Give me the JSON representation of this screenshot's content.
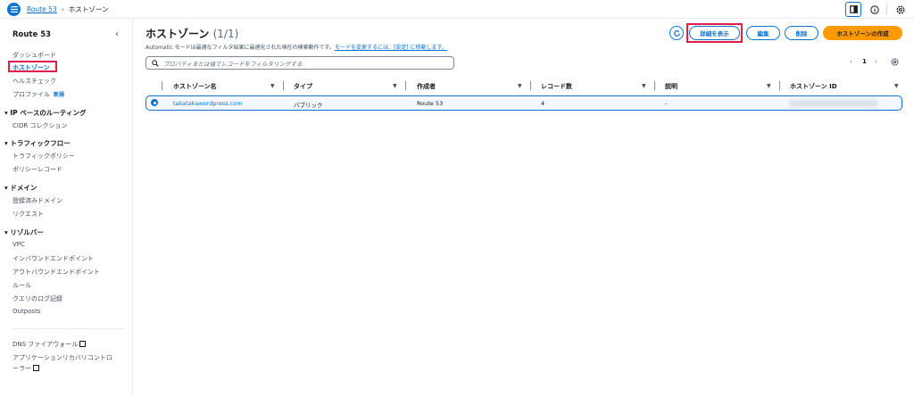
{
  "breadcrumb": {
    "service": "Route 53",
    "current": "ホストゾーン"
  },
  "sidebar": {
    "title": "Route 53",
    "top_items": [
      "ダッシュボード",
      "ホストゾーン",
      "ヘルスチェック",
      "プロファイル"
    ],
    "new_badge": "新規",
    "sections": [
      {
        "title": "IP ベースのルーティング",
        "items": [
          "CIDR コレクション"
        ]
      },
      {
        "title": "トラフィックフロー",
        "items": [
          "トラフィックポリシー",
          "ポリシーレコード"
        ]
      },
      {
        "title": "ドメイン",
        "items": [
          "登録済みドメイン",
          "リクエスト"
        ]
      },
      {
        "title": "リゾルバー",
        "items": [
          "VPC",
          "インバウンドエンドポイント",
          "アウトバウンドエンドポイント",
          "ルール",
          "クエリのログ記録",
          "Outposts"
        ]
      }
    ],
    "bottom_items": [
      "DNS ファイアウォール",
      "アプリケーションリカバリコントロ",
      "ーラー"
    ]
  },
  "main": {
    "title": "ホストゾーン",
    "count": "(1/1)",
    "description": "Automatic モードは最適なフィルタ結果に最適化された現在の検索動作です。",
    "description_link": "モードを変更するには、[設定] に移動します。",
    "buttons": {
      "details": "詳細を表示",
      "edit": "編集",
      "delete": "削除",
      "create": "ホストゾーンの作成"
    },
    "search_placeholder": "プロパティまたは値でレコードをフィルタリングする",
    "page": "1"
  },
  "table": {
    "headers": [
      "ホストゾーン名",
      "タイプ",
      "作成者",
      "レコード数",
      "説明",
      "ホストゾーン ID"
    ],
    "rows": [
      {
        "name": "takatakawordpress.com",
        "type": "パブリック",
        "creator": "Route 53",
        "records": "4",
        "description": "-"
      }
    ]
  },
  "colors": {
    "accent": "#0972d3",
    "primary_button": "#ff9900",
    "highlight": "#e11d48"
  }
}
